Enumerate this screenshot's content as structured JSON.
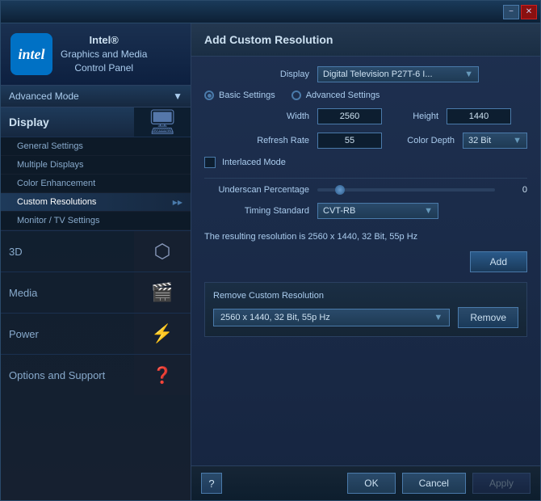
{
  "window": {
    "minimize_label": "−",
    "close_label": "✕"
  },
  "sidebar": {
    "logo_text": "intel",
    "title_line1": "Intel®",
    "title_line2": "Graphics and Media",
    "title_line3": "Control Panel",
    "mode_label": "Advanced Mode",
    "nav": {
      "display_label": "Display",
      "sub_items": [
        {
          "label": "General Settings",
          "active": false
        },
        {
          "label": "Multiple Displays",
          "active": false
        },
        {
          "label": "Color Enhancement",
          "active": false
        },
        {
          "label": "Custom Resolutions",
          "active": true
        },
        {
          "label": "Monitor / TV Settings",
          "active": false
        }
      ],
      "main_items": [
        {
          "label": "3D",
          "icon": "cube"
        },
        {
          "label": "Media",
          "icon": "film"
        },
        {
          "label": "Power",
          "icon": "bolt"
        },
        {
          "label": "Options and Support",
          "icon": "question"
        }
      ]
    }
  },
  "panel": {
    "title": "Add Custom Resolution",
    "display_label": "Display",
    "display_value": "Digital Television P27T-6 I...",
    "basic_settings_label": "Basic Settings",
    "advanced_settings_label": "Advanced Settings",
    "width_label": "Width",
    "width_value": "2560",
    "height_label": "Height",
    "height_value": "1440",
    "refresh_rate_label": "Refresh Rate",
    "refresh_rate_value": "55",
    "color_depth_label": "Color Depth",
    "color_depth_value": "32 Bit",
    "interlaced_label": "Interlaced Mode",
    "underscan_label": "Underscan Percentage",
    "underscan_value": "0",
    "timing_label": "Timing Standard",
    "timing_value": "CVT-RB",
    "result_text": "The resulting resolution is 2560 x 1440, 32 Bit, 55p Hz",
    "add_btn_label": "Add",
    "remove_section_title": "Remove Custom Resolution",
    "remove_value": "2560 x 1440, 32 Bit, 55p Hz",
    "remove_btn_label": "Remove",
    "footer": {
      "help_label": "?",
      "ok_label": "OK",
      "cancel_label": "Cancel",
      "apply_label": "Apply"
    }
  }
}
